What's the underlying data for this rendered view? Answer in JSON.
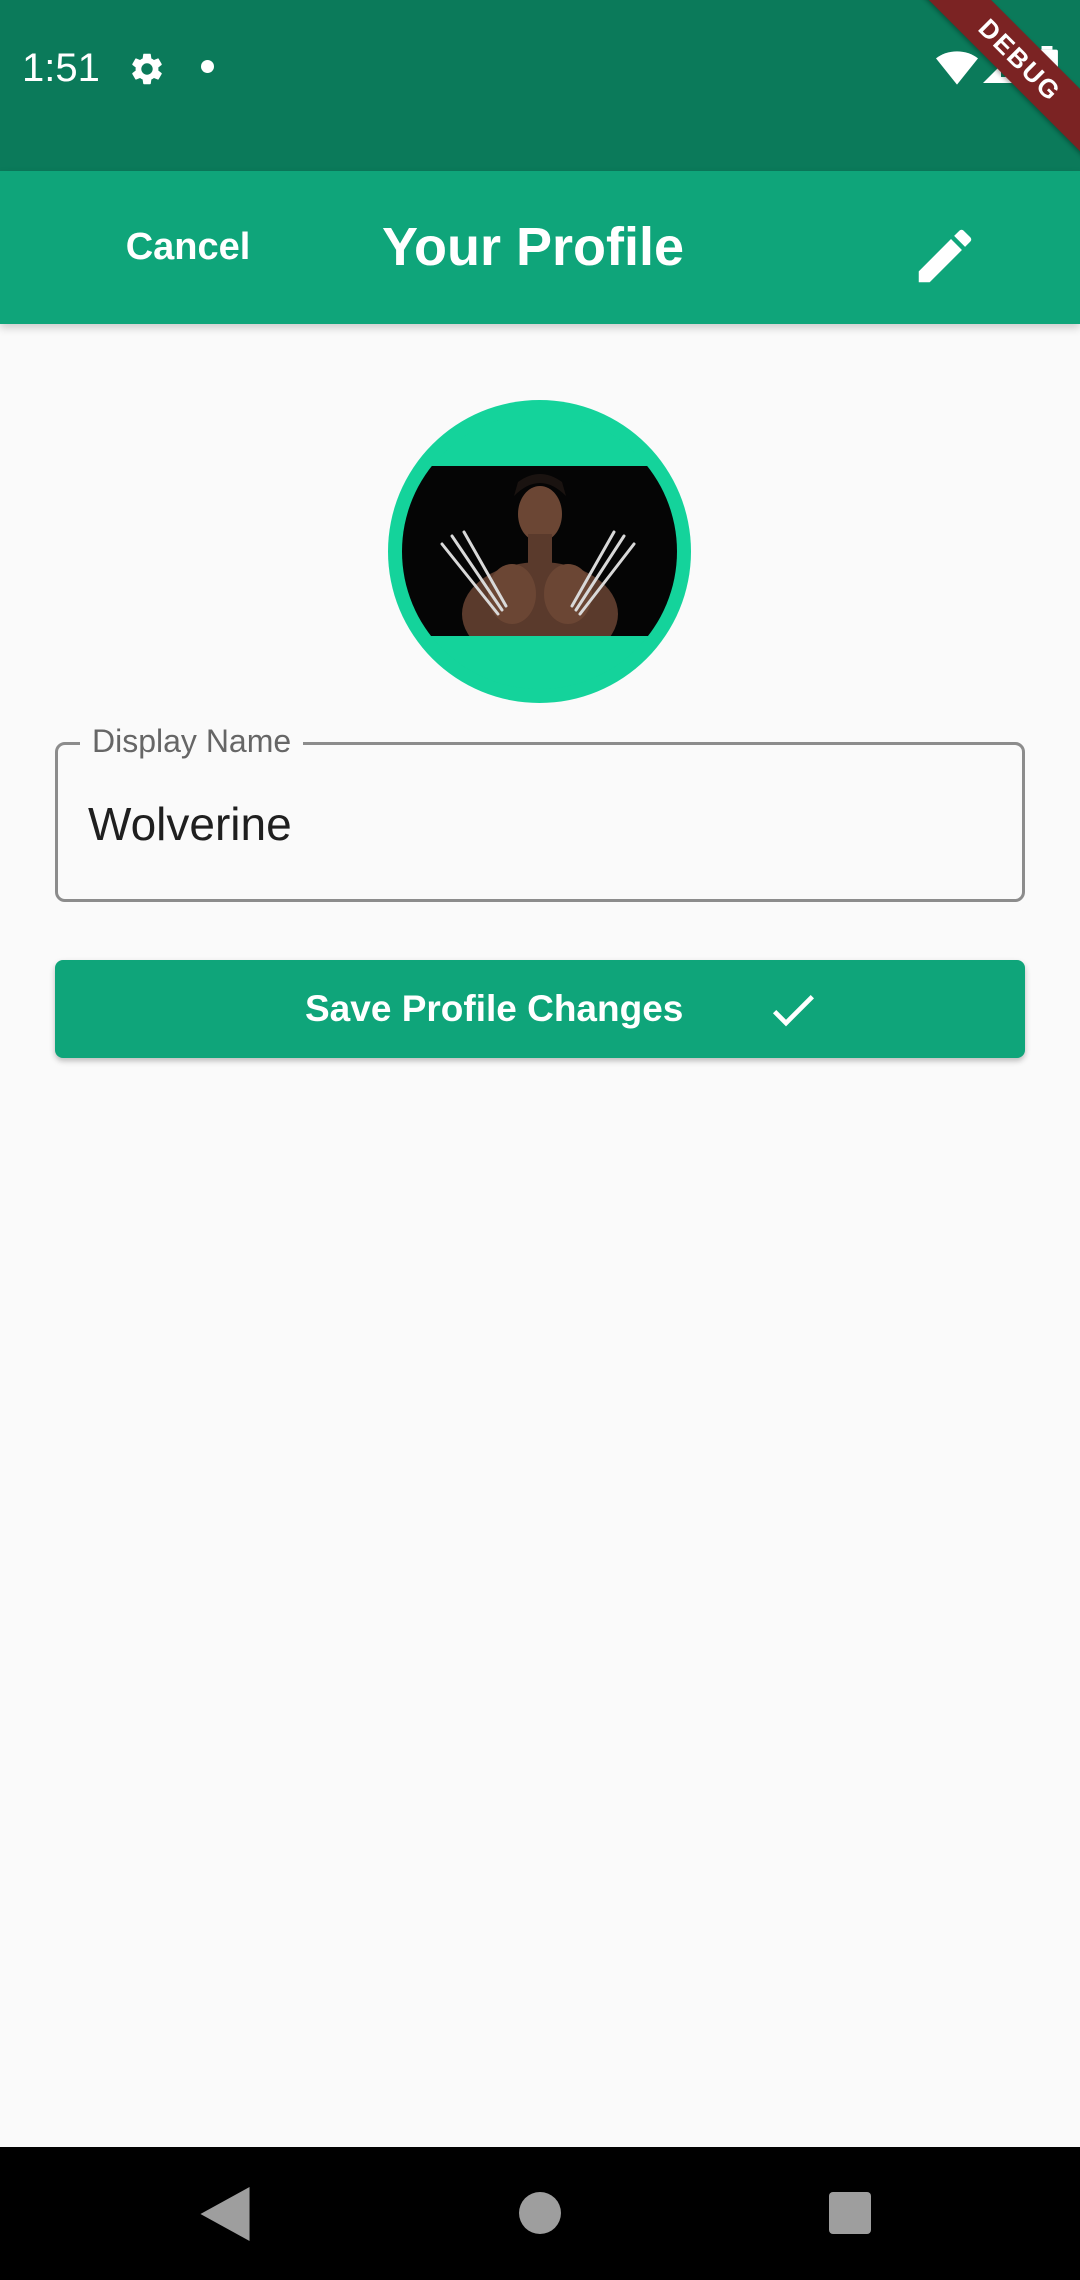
{
  "status_bar": {
    "time": "1:51",
    "icons": [
      "settings-icon",
      "notification-dot-icon",
      "wifi-icon",
      "signal-icon",
      "battery-icon"
    ]
  },
  "debug_banner": {
    "label": "DEBUG"
  },
  "app_bar": {
    "cancel_label": "Cancel",
    "title": "Your Profile",
    "edit_icon": "pencil-icon"
  },
  "profile": {
    "avatar_description": "profile-photo"
  },
  "display_name_field": {
    "label": "Display Name",
    "value": "Wolverine"
  },
  "save_button": {
    "label": "Save Profile Changes",
    "icon": "check-icon"
  },
  "nav_bar": {
    "icons": [
      "back-icon",
      "home-icon",
      "recents-icon"
    ]
  },
  "colors": {
    "status_bar": "#0b7a5a",
    "app_bar": "#0fa57a",
    "avatar_ring": "#14d39b",
    "background": "#fafafa",
    "debug_banner": "#7b2323"
  }
}
